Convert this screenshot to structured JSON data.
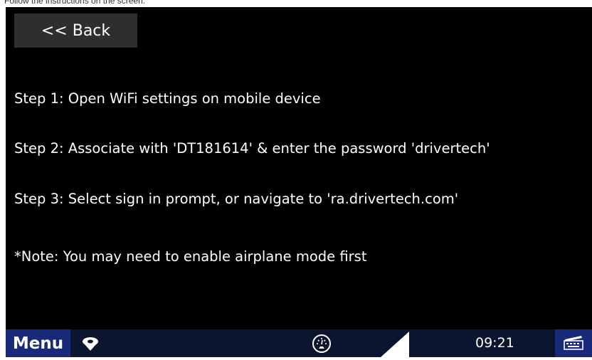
{
  "caption": "Follow the instructions on the screen.",
  "back_label": "<< Back",
  "steps": [
    "Step 1:  Open WiFi settings on mobile device",
    "Step 2:  Associate with 'DT181614' & enter the password 'drivertech'",
    "Step 3:  Select sign in prompt, or navigate to 'ra.drivertech.com'",
    "*Note: You may need to enable airplane mode first"
  ],
  "taskbar": {
    "menu_label": "Menu",
    "time": "09:21",
    "icons": [
      "navigation-icon",
      "speedometer-icon",
      "signal-strength-icon",
      "keyboard-icon"
    ]
  },
  "colors": {
    "screen_bg": "#000000",
    "back_button_bg": "#2e2e2e",
    "taskbar_bg": "#0b1530",
    "accent_blue": "#1a2a7a",
    "text": "#ffffff"
  }
}
